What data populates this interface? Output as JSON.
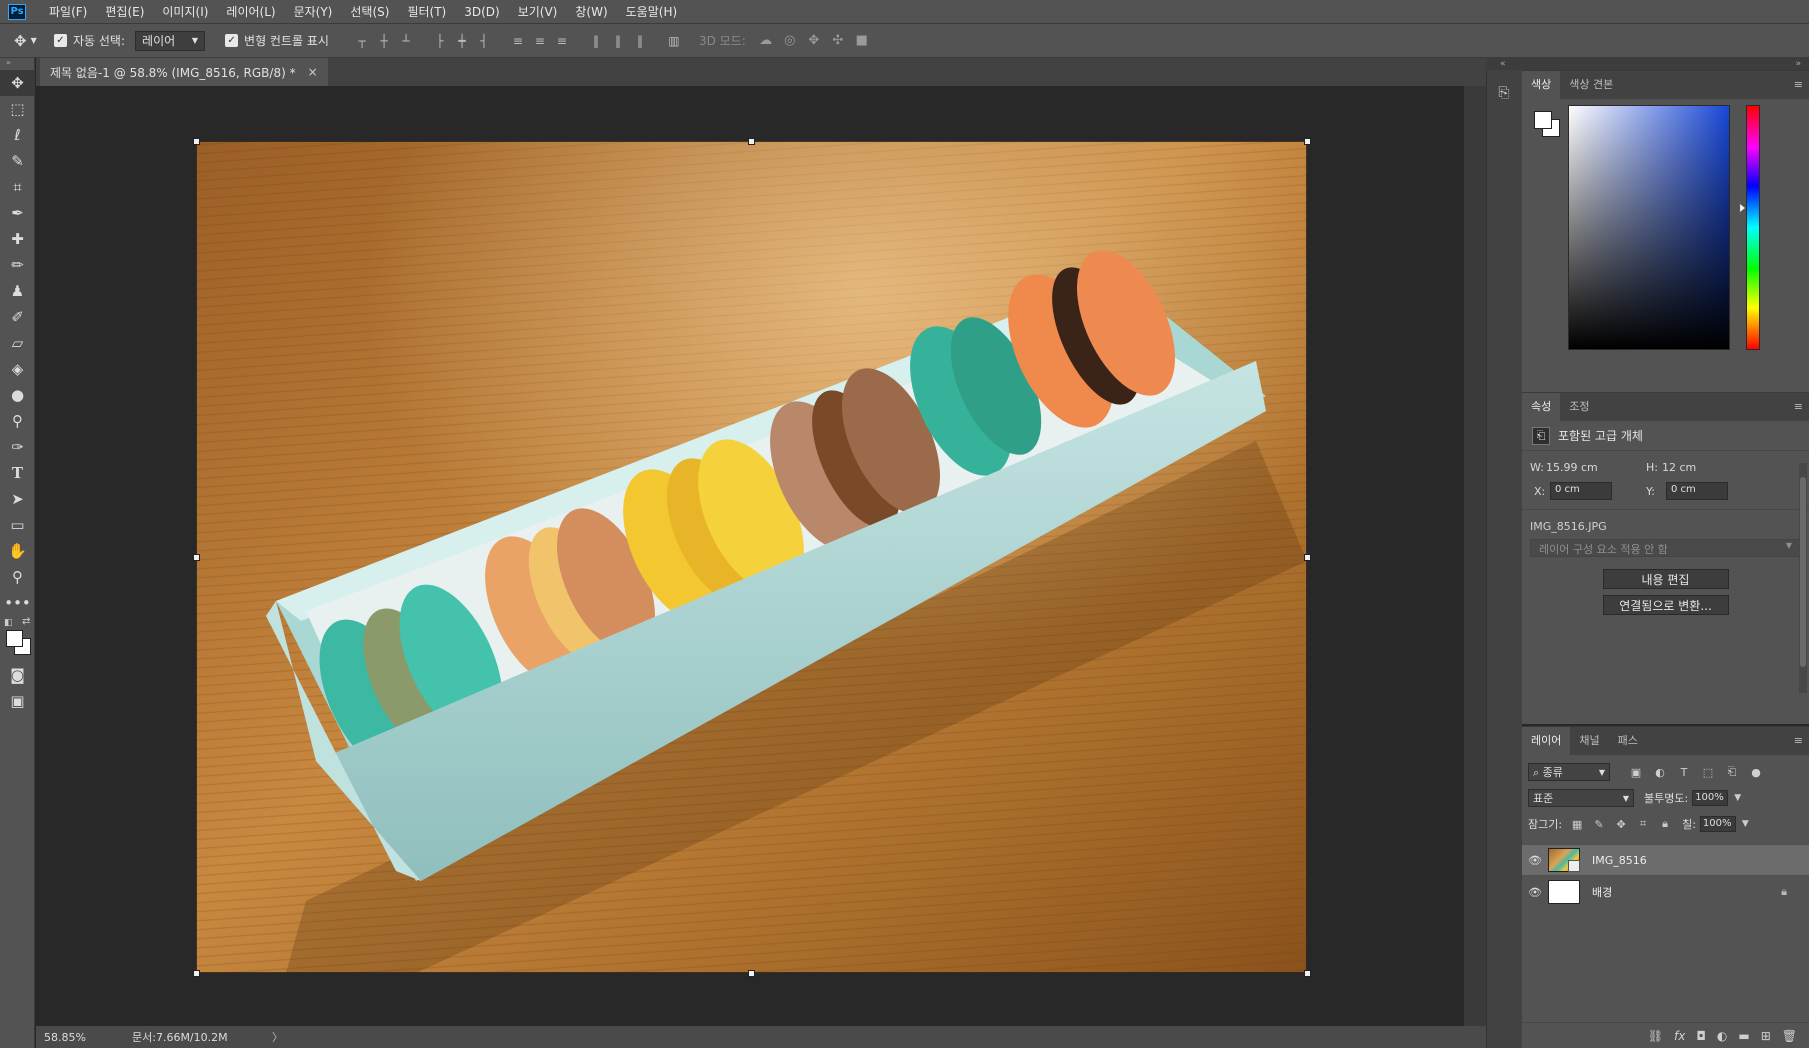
{
  "app": {
    "logo": "Ps"
  },
  "menu": [
    "파일(F)",
    "편집(E)",
    "이미지(I)",
    "레이어(L)",
    "문자(Y)",
    "선택(S)",
    "필터(T)",
    "3D(D)",
    "보기(V)",
    "창(W)",
    "도움말(H)"
  ],
  "options": {
    "tool_icon": "move-icon",
    "auto_select_label": "자동 선택:",
    "auto_select_checked": true,
    "auto_select_value": "레이어",
    "show_transform_label": "변형 컨트롤 표시",
    "show_transform_checked": true,
    "mode3d_label": "3D 모드:"
  },
  "document": {
    "tab_title": "제목 없음-1 @ 58.8% (IMG_8516, RGB/8) *",
    "close_glyph": "×"
  },
  "status": {
    "zoom": "58.85%",
    "doc_size": "문서:7.66M/10.2M",
    "arrow": "〉"
  },
  "tools": [
    "move-tool",
    "marquee-tool",
    "lasso-tool",
    "quick-select-tool",
    "crop-tool",
    "eyedropper-tool",
    "healing-brush-tool",
    "brush-tool",
    "clone-stamp-tool",
    "history-brush-tool",
    "eraser-tool",
    "paint-bucket-tool",
    "blur-tool",
    "dodge-tool",
    "pen-tool",
    "type-tool",
    "path-select-tool",
    "rectangle-tool",
    "hand-tool",
    "zoom-tool",
    "more-tools"
  ],
  "colors": {
    "foreground": "#ffffff",
    "background": "#ffffff"
  },
  "color_panel": {
    "tabs": [
      "색상",
      "색상 견본"
    ]
  },
  "properties": {
    "tabs": [
      "속성",
      "조정"
    ],
    "type_label": "포함된 고급 개체",
    "w_label": "W:",
    "w_value": "15.99 cm",
    "h_label": "H:",
    "h_value": "12 cm",
    "x_label": "X:",
    "x_value": "0 cm",
    "y_label": "Y:",
    "y_value": "0 cm",
    "file_name": "IMG_8516.JPG",
    "comp_dropdown": "레이어 구성 요소 적용 안 함",
    "edit_contents_button": "내용 편집",
    "convert_linked_button": "연결됨으로 변환..."
  },
  "layers": {
    "tabs": [
      "레이어",
      "채널",
      "패스"
    ],
    "kind_filter": "종류",
    "blend_mode": "표준",
    "opacity_label": "불투명도:",
    "opacity_value": "100%",
    "lock_label": "잠그기:",
    "fill_label": "칠:",
    "fill_value": "100%",
    "items": [
      {
        "name": "IMG_8516",
        "selected": true,
        "locked": false
      },
      {
        "name": "배경",
        "selected": false,
        "locked": true
      }
    ]
  }
}
